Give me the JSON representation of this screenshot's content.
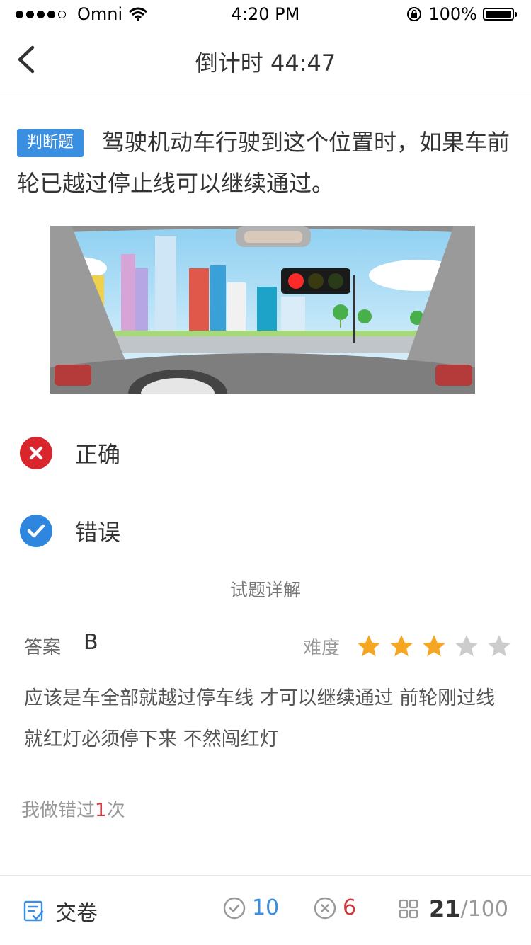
{
  "status_bar": {
    "carrier": "Omni",
    "time": "4:20 PM",
    "battery": "100%"
  },
  "nav": {
    "title": "倒计时 44:47"
  },
  "question": {
    "type_tag": "判断题",
    "text": "驾驶机动车行驶到这个位置时，如果车前轮已越过停止线可以继续通过。"
  },
  "options": [
    {
      "label": "正确",
      "state": "wrong",
      "icon": "x-circle-icon",
      "color": "#d9252c"
    },
    {
      "label": "错误",
      "state": "correct",
      "icon": "check-circle-icon",
      "color": "#2e86de"
    }
  ],
  "detail": {
    "title": "试题详解",
    "answer_label": "答案",
    "answer_value": "B",
    "difficulty_label": "难度",
    "difficulty_stars": 3,
    "difficulty_max": 5,
    "explanation": "应该是车全部就越过停车线 才可以继续通过 前轮刚过线就红灯必须停下来 不然闯红灯"
  },
  "history": {
    "prefix": "我做错过",
    "count": "1",
    "suffix": "次"
  },
  "bottom_bar": {
    "submit_label": "交卷",
    "correct_count": "10",
    "wrong_count": "6",
    "current": "21",
    "total": "/100"
  },
  "colors": {
    "accent": "#3a8fe0",
    "error": "#d0393e",
    "star_on": "#f5a623",
    "star_off": "#cccccc"
  }
}
